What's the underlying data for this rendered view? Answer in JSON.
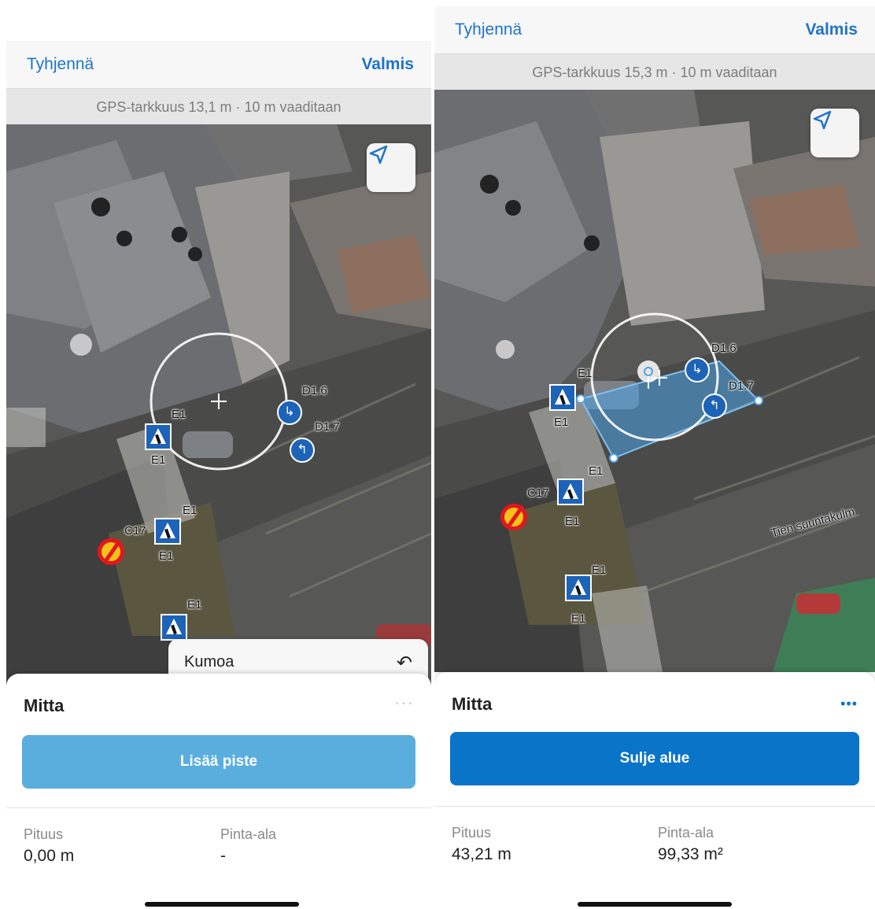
{
  "left": {
    "topbar": {
      "clear_label": "Tyhjennä",
      "done_label": "Valmis"
    },
    "gps_text": "GPS-tarkkuus 13,1 m · 10 m vaaditaan",
    "undo": {
      "label": "Kumoa",
      "icon": "undo-icon"
    },
    "panel": {
      "title": "Mitta",
      "more_label": "···",
      "action_label": "Lisää piste",
      "length_label": "Pituus",
      "length_value": "0,00 m",
      "area_label": "Pinta-ala",
      "area_value": "-"
    },
    "map_labels": {
      "e1_a": "E1",
      "e1_b": "E1",
      "e1_c": "E1",
      "e1_d": "E1",
      "e1_e": "E1",
      "d16": "D1.6",
      "d17": "D1.7",
      "c17": "C17"
    },
    "colors": {
      "action": "#5aaede"
    }
  },
  "right": {
    "topbar": {
      "clear_label": "Tyhjennä",
      "done_label": "Valmis"
    },
    "gps_text": "GPS-tarkkuus 15,3 m · 10 m vaaditaan",
    "panel": {
      "title": "Mitta",
      "more_label": "•••",
      "action_label": "Sulje alue",
      "length_label": "Pituus",
      "length_value": "43,21 m",
      "area_label": "Pinta-ala",
      "area_value": "99,33 m²"
    },
    "map_labels": {
      "e1_a": "E1",
      "e1_b": "E1",
      "e1_c": "E1",
      "e1_d": "E1",
      "e1_e": "E1",
      "e1_f": "E1",
      "d16": "D1.6",
      "d17": "D1.7",
      "c17": "C17",
      "road": "Tien suuntakulm"
    },
    "colors": {
      "action": "#0a74c9",
      "polygon": "#4da3e8"
    }
  }
}
